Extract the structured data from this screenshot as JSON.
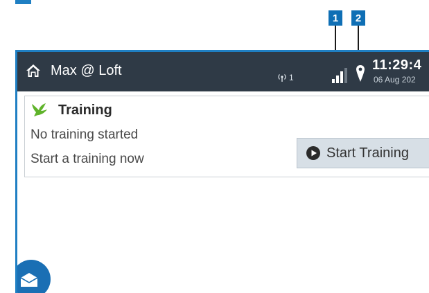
{
  "header": {
    "title": "Max @ Loft",
    "antenna_count": "1",
    "time": "11:29:4",
    "date": "06 Aug 202"
  },
  "callouts": {
    "first": "1",
    "second": "2"
  },
  "training": {
    "title": "Training",
    "status": "No training started",
    "prompt": "Start a training now",
    "button_label": "Start Training"
  },
  "icons": {
    "home": "home-icon",
    "antenna": "antenna-icon",
    "signal": "signal-strength-icon",
    "location": "location-pin-icon",
    "bird": "bird-icon",
    "play": "play-icon",
    "message": "envelope-icon"
  },
  "colors": {
    "header_bg": "#2f3a46",
    "accent_blue": "#1f7fc3",
    "callout_blue": "#0f6fb5",
    "bird_green": "#5fb32a",
    "button_bg": "#d7dfe6"
  }
}
